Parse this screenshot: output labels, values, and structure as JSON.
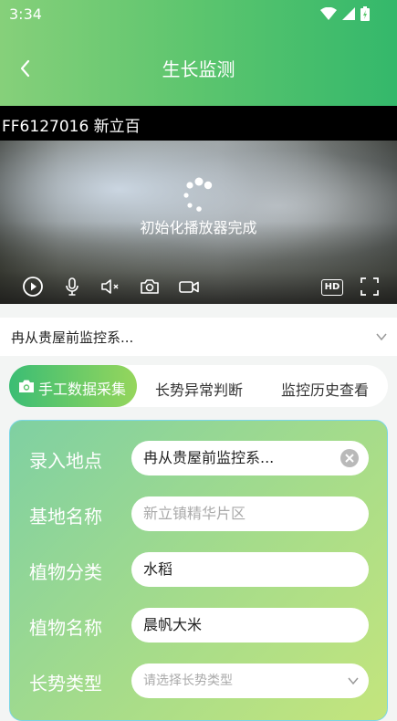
{
  "status_bar": {
    "time": "3:34"
  },
  "header": {
    "title": "生长监测"
  },
  "video": {
    "device_name": "FF6127016 新立百",
    "loading_text": "初始化播放器完成",
    "hd_label": "HD"
  },
  "location_select": {
    "value": "冉从贵屋前监控系..."
  },
  "tabs": [
    {
      "label": "手工数据采集",
      "active": true
    },
    {
      "label": "长势异常判断",
      "active": false
    },
    {
      "label": "监控历史查看",
      "active": false
    }
  ],
  "form": {
    "location": {
      "label": "录入地点",
      "value": "冉从贵屋前监控系..."
    },
    "base_name": {
      "label": "基地名称",
      "placeholder": "新立镇精华片区"
    },
    "plant_category": {
      "label": "植物分类",
      "value": "水稻"
    },
    "plant_name": {
      "label": "植物名称",
      "value": "晨帆大米"
    },
    "growth_type": {
      "label": "长势类型",
      "placeholder": "请选择长势类型"
    }
  },
  "colors": {
    "accent_green": "#34b86b",
    "light_green": "#96d65c",
    "form_border": "#7ad6e6"
  }
}
